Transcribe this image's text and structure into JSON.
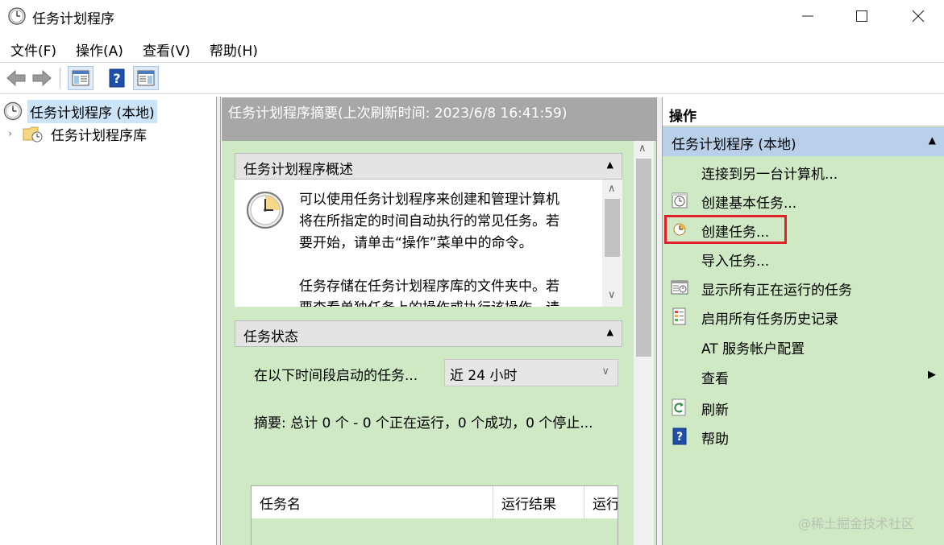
{
  "window": {
    "title": "任务计划程序"
  },
  "menu": [
    "文件(F)",
    "操作(A)",
    "查看(V)",
    "帮助(H)"
  ],
  "tree": {
    "root_label": "任务计划程序 (本地)",
    "child_label": "任务计划程序库"
  },
  "middle": {
    "header": "任务计划程序摘要(上次刷新时间: 2023/6/8 16:41:59)",
    "overview": {
      "title": "任务计划程序概述",
      "lines": [
        "可以使用任务计划程序来创建和管理计算机",
        "将在所指定的时间自动执行的常见任务。若",
        "要开始，请单击“操作”菜单中的命令。",
        "",
        "任务存储在任务计划程序库的文件夹中。若",
        "要查看单独任务上的操作或执行该操作，请"
      ]
    },
    "status": {
      "title": "任务状态",
      "period_label": "在以下时间段启动的任务...",
      "period_value": "近 24 小时",
      "summary": "摘要: 总计 0 个 - 0 个正在运行，0 个成功，0 个停止...",
      "table_columns": [
        "任务名",
        "运行结果",
        "运行"
      ]
    }
  },
  "actions": {
    "title": "操作",
    "group_label": "任务计划程序 (本地)",
    "items": [
      {
        "label": "连接到另一台计算机...",
        "icon": "none"
      },
      {
        "label": "创建基本任务...",
        "icon": "basic-task-icon"
      },
      {
        "label": "创建任务...",
        "icon": "create-task-icon"
      },
      {
        "label": "导入任务...",
        "icon": "none"
      },
      {
        "label": "显示所有正在运行的任务",
        "icon": "running-tasks-icon"
      },
      {
        "label": "启用所有任务历史记录",
        "icon": "history-icon"
      },
      {
        "label": "AT 服务帐户配置",
        "icon": "none"
      },
      {
        "label": "查看",
        "icon": "none"
      },
      {
        "label": "刷新",
        "icon": "refresh-icon"
      },
      {
        "label": "帮助",
        "icon": "help-icon"
      }
    ]
  },
  "watermark": "@稀土掘金技术社区",
  "colors": {
    "panel_green": "#cfe9c5",
    "header_gray": "#a7a7a7",
    "group_blue": "#b9d0ea",
    "highlight_red": "#e0202a",
    "selected_blue": "#cce4f7"
  }
}
